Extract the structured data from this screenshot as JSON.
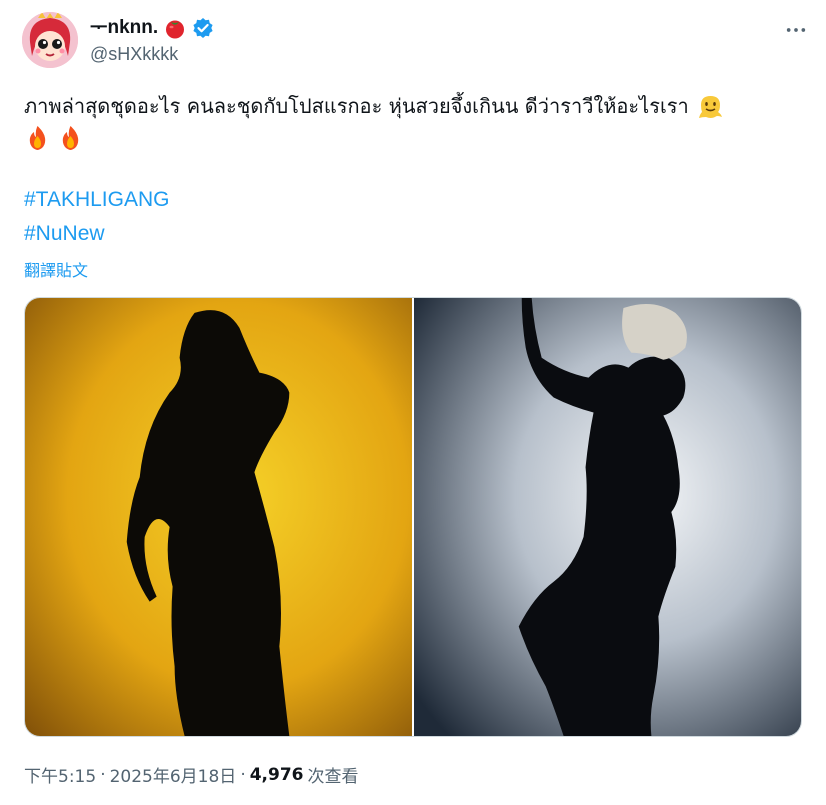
{
  "author": {
    "display_name": "ᅮnknn.",
    "handle": "@sHXkkkk",
    "avatar_icon": "cartoon-girl-avatar",
    "name_emoji": "tomato-icon",
    "verified_icon": "verified-badge-icon",
    "verified_color": "#1d9bf0"
  },
  "more_icon": "more-dots-icon",
  "tweet": {
    "text": "ภาพล่าสุดชุดอะไร คนละชุดกับโปสแรกอะ หุ่นสวยจึ้งเกินน ดีว่าราวีให้อะไรเรา",
    "trailing_emoji": "melting-face-icon",
    "emojis_line2": [
      "fire-icon",
      "fire-icon"
    ],
    "hashtags": [
      "#TAKHLIGANG",
      "#NuNew"
    ],
    "translate_label": "翻譯貼文"
  },
  "media": {
    "photos": [
      {
        "alt_desc": "silhouette-yellow",
        "bg": "#e3a512"
      },
      {
        "alt_desc": "silhouette-grey",
        "bg": "#8a97a6"
      }
    ]
  },
  "footer": {
    "time": "下午5:15",
    "separator": "·",
    "date": "2025年6月18日",
    "views_count": "4,976",
    "views_label": "次查看"
  },
  "colors": {
    "link": "#1d9bf0",
    "secondary_text": "#536471",
    "primary_text": "#0f1419"
  }
}
